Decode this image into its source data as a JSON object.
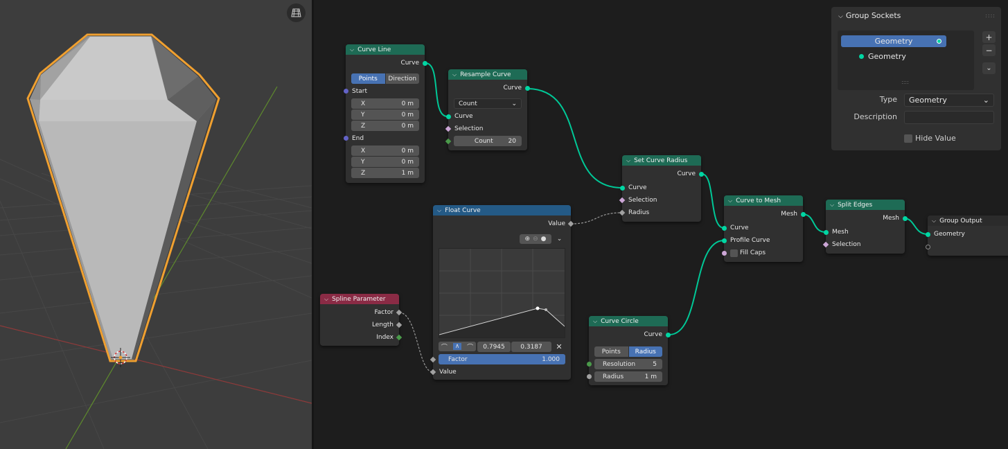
{
  "colors": {
    "geometry_socket": "#00d6a3",
    "vector_socket": "#6363c7",
    "selection_accent": "#4772b3",
    "outline_orange": "#f0a030",
    "header_green": "#1e6b55",
    "header_blue": "#245a86",
    "header_red": "#8a2b45"
  },
  "viewport": {
    "overlay_icon": "grid-icon"
  },
  "nodes": {
    "curve_line": {
      "title": "Curve Line",
      "out_curve": "Curve",
      "mode": [
        "Points",
        "Direction"
      ],
      "start_label": "Start",
      "start": [
        {
          "axis": "X",
          "value": "0 m"
        },
        {
          "axis": "Y",
          "value": "0 m"
        },
        {
          "axis": "Z",
          "value": "0 m"
        }
      ],
      "end_label": "End",
      "end": [
        {
          "axis": "X",
          "value": "0 m"
        },
        {
          "axis": "Y",
          "value": "0 m"
        },
        {
          "axis": "Z",
          "value": "1 m"
        }
      ]
    },
    "resample_curve": {
      "title": "Resample Curve",
      "out_curve": "Curve",
      "mode": "Count",
      "in_curve": "Curve",
      "in_selection": "Selection",
      "count_label": "Count",
      "count_value": "20"
    },
    "set_curve_radius": {
      "title": "Set Curve Radius",
      "out_curve": "Curve",
      "in_curve": "Curve",
      "in_selection": "Selection",
      "in_radius": "Radius"
    },
    "float_curve": {
      "title": "Float Curve",
      "out_value": "Value",
      "point_x": "0.7945",
      "point_y": "0.3187",
      "factor_label": "Factor",
      "factor_value": "1.000",
      "in_value": "Value"
    },
    "spline_parameter": {
      "title": "Spline Parameter",
      "out_factor": "Factor",
      "out_length": "Length",
      "out_index": "Index"
    },
    "curve_circle": {
      "title": "Curve Circle",
      "out_curve": "Curve",
      "mode": [
        "Points",
        "Radius"
      ],
      "resolution_label": "Resolution",
      "resolution_value": "5",
      "radius_label": "Radius",
      "radius_value": "1 m"
    },
    "curve_to_mesh": {
      "title": "Curve to Mesh",
      "out_mesh": "Mesh",
      "in_curve": "Curve",
      "in_profile": "Profile Curve",
      "fill_caps": "Fill Caps"
    },
    "split_edges": {
      "title": "Split Edges",
      "out_mesh": "Mesh",
      "in_mesh": "Mesh",
      "in_selection": "Selection"
    },
    "group_output": {
      "title": "Group Output",
      "in_geometry": "Geometry"
    }
  },
  "panel": {
    "title": "Group Sockets",
    "sockets": [
      "Geometry",
      "Geometry"
    ],
    "add": "+",
    "remove": "−",
    "type_label": "Type",
    "type_value": "Geometry",
    "description_label": "Description",
    "description_value": "",
    "hide_value_label": "Hide Value"
  }
}
